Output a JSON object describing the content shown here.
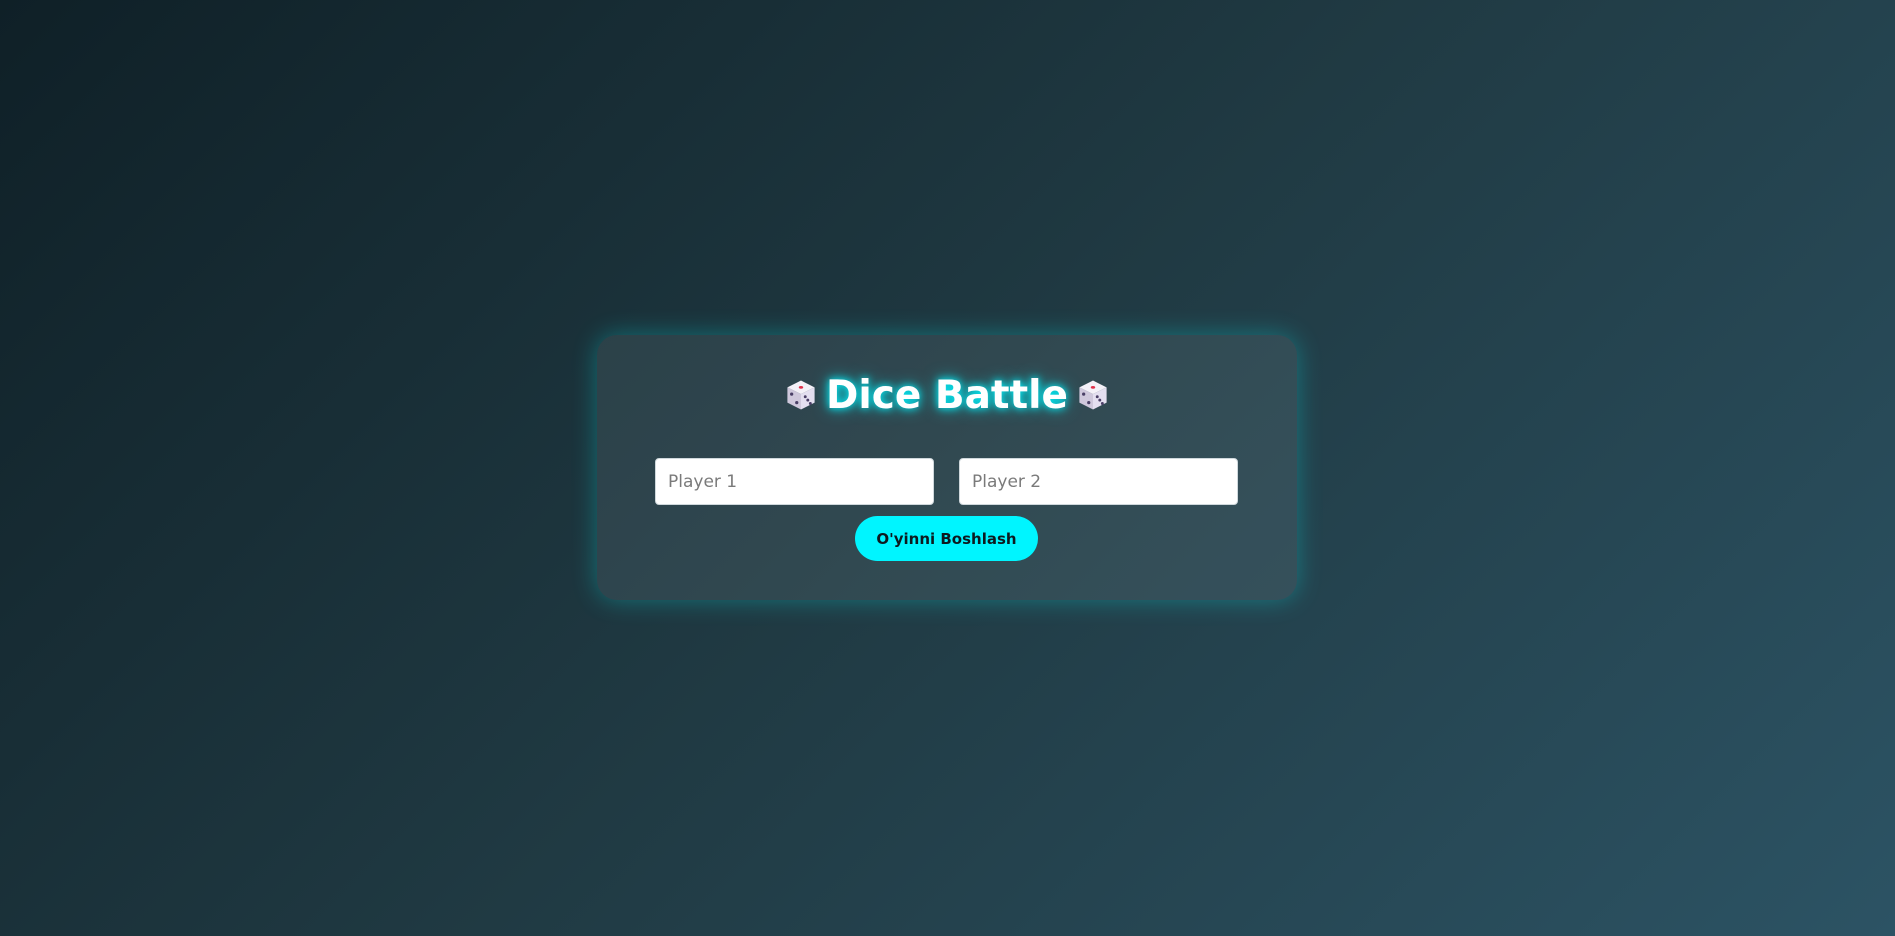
{
  "title": {
    "text": "Dice Battle",
    "left_icon": "dice-icon",
    "right_icon": "dice-icon"
  },
  "inputs": {
    "player1": {
      "placeholder": "Player 1",
      "value": ""
    },
    "player2": {
      "placeholder": "Player 2",
      "value": ""
    }
  },
  "start_button": {
    "label": "O'yinni Boshlash"
  },
  "colors": {
    "accent": "#00f5ff",
    "background_start": "#0f2027",
    "background_end": "#2c5364",
    "input_background": "#ffffff"
  }
}
